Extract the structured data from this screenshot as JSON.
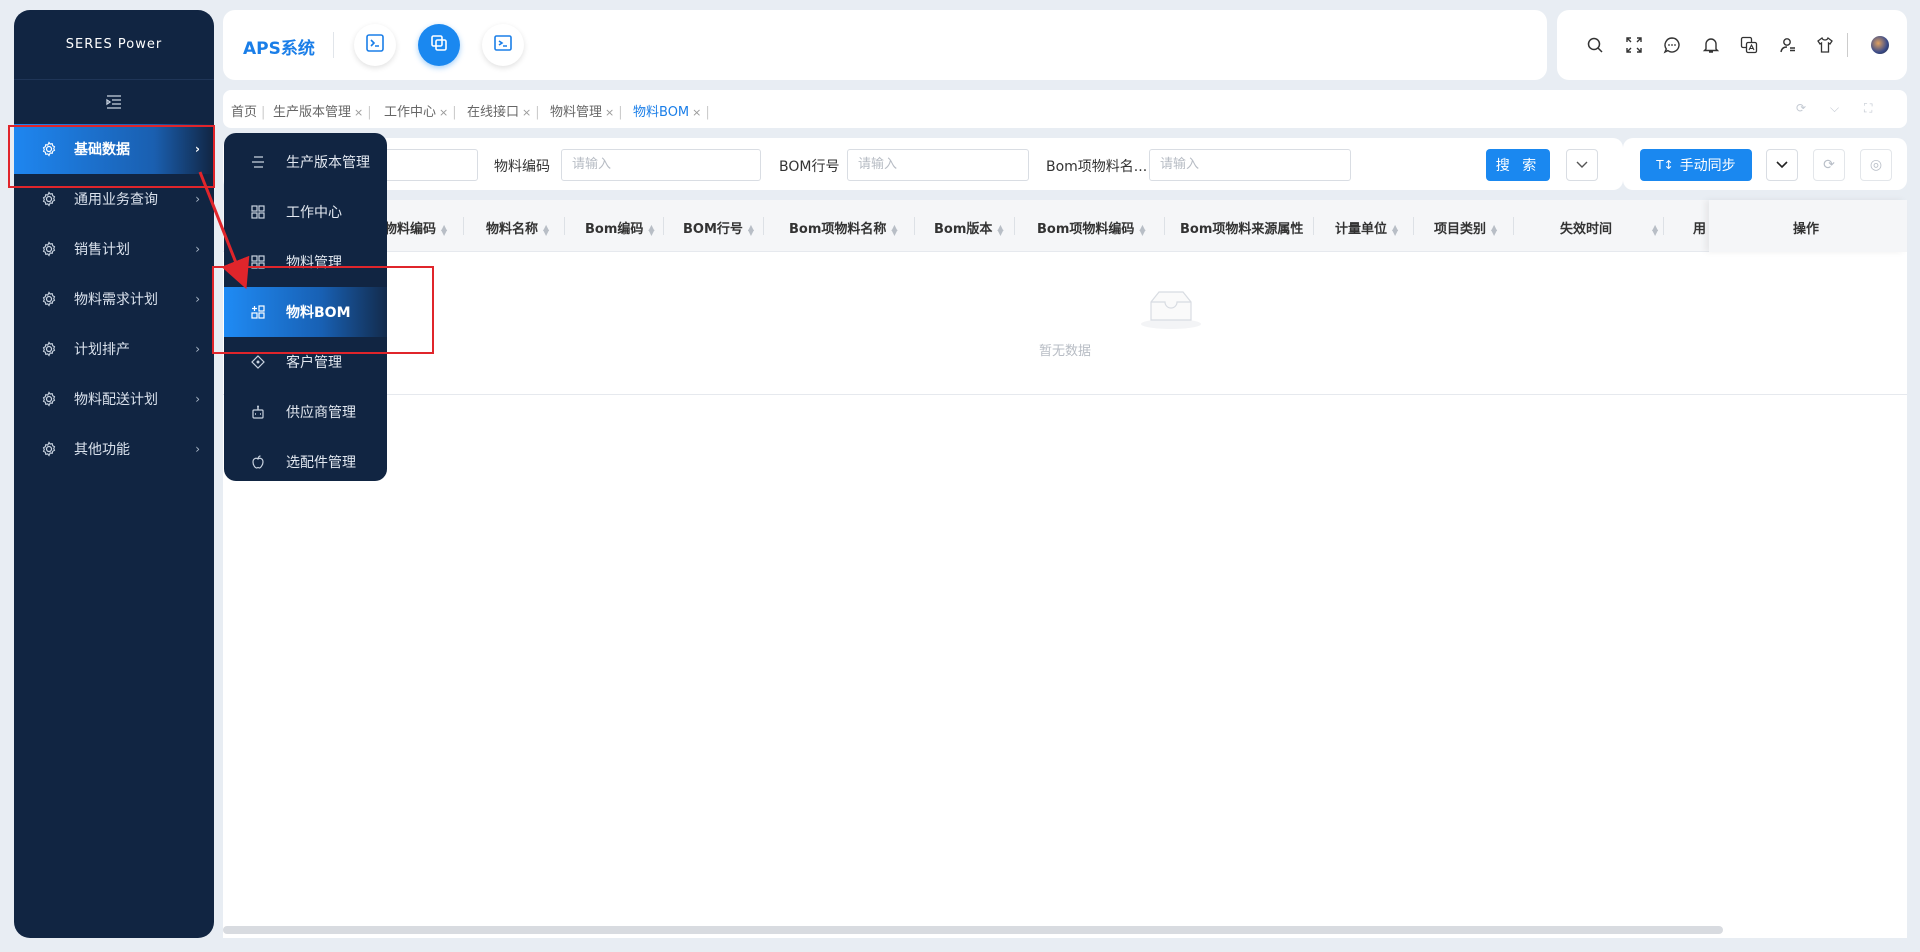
{
  "brand": {
    "logo_text": "SERES Power",
    "app_title": "APS系统"
  },
  "sidebar": {
    "items": [
      {
        "label": "基础数据",
        "icon": "gear-icon",
        "active": true
      },
      {
        "label": "通用业务查询",
        "icon": "gear-icon"
      },
      {
        "label": "销售计划",
        "icon": "gear-icon"
      },
      {
        "label": "物料需求计划",
        "icon": "gear-icon"
      },
      {
        "label": "计划排产",
        "icon": "gear-icon"
      },
      {
        "label": "物料配送计划",
        "icon": "gear-icon"
      },
      {
        "label": "其他功能",
        "icon": "gear-icon"
      }
    ]
  },
  "submenu": {
    "items": [
      {
        "label": "生产版本管理",
        "icon": "list-icon"
      },
      {
        "label": "工作中心",
        "icon": "grid-icon"
      },
      {
        "label": "物料管理",
        "icon": "grid-icon"
      },
      {
        "label": "物料BOM",
        "icon": "grid-plus-icon",
        "active": true
      },
      {
        "label": "客户管理",
        "icon": "diamond-icon"
      },
      {
        "label": "供应商管理",
        "icon": "robot-icon"
      },
      {
        "label": "选配件管理",
        "icon": "apple-icon"
      }
    ]
  },
  "tabs": [
    {
      "label": "首页"
    },
    {
      "label": "生产版本管理"
    },
    {
      "label": "工作中心"
    },
    {
      "label": "在线接口"
    },
    {
      "label": "物料管理"
    },
    {
      "label": "物料BOM",
      "active": true
    }
  ],
  "filter": {
    "field2_label": "物料编码",
    "field2_placeholder": "请输入",
    "field3_label": "BOM行号",
    "field3_placeholder": "请输入",
    "field4_label": "Bom项物料名...",
    "field4_placeholder": "请输入",
    "search_label": "搜 索"
  },
  "actions": {
    "sync_label": "手动同步"
  },
  "table": {
    "columns": [
      "物料编码",
      "物料名称",
      "Bom编码",
      "BOM行号",
      "Bom项物料名称",
      "Bom版本",
      "Bom项物料编码",
      "Bom项物料来源属性",
      "计量单位",
      "项目类别",
      "失效时间",
      "用",
      "操作"
    ],
    "empty_text": "暂无数据"
  },
  "colors": {
    "accent": "#1a88f0",
    "sidebar_bg": "#112542",
    "highlight": "#e0252b"
  }
}
